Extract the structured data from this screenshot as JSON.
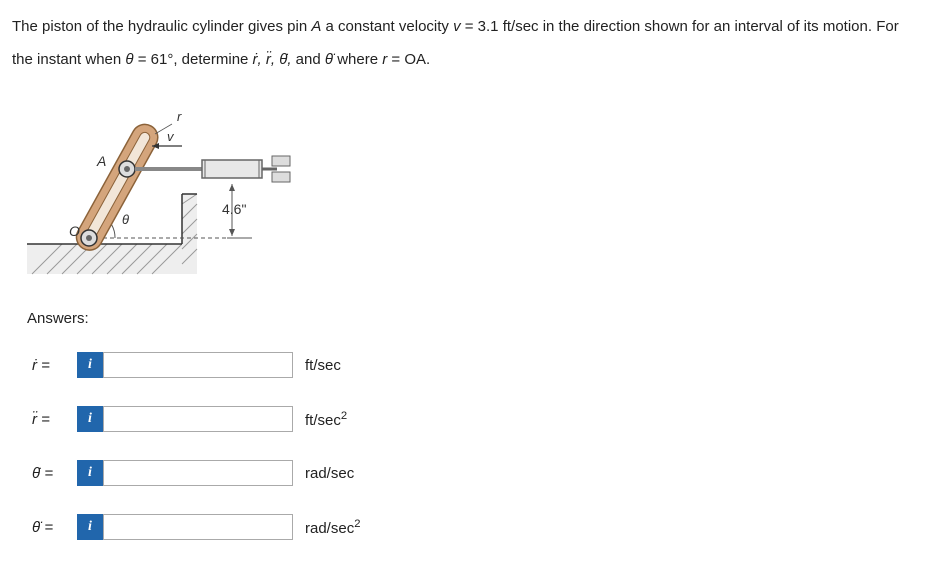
{
  "problem": {
    "line1_pre": "The piston of the hydraulic cylinder gives pin ",
    "line1_a": "A",
    "line1_mid": " a constant velocity ",
    "line1_v": "v",
    "line1_post": " = 3.1 ft/sec in the direction shown for an interval of its motion. For",
    "line2_pre": "the instant when ",
    "line2_theta": "θ",
    "line2_mid1": " = 61°, determine ",
    "line2_vars": "ṙ, r̈, θ̇,",
    "line2_mid2": "  and ",
    "line2_var2": "θ̈",
    "line2_mid3": " where ",
    "line2_r": "r",
    "line2_post": " = OA."
  },
  "diagram": {
    "dimension": "4.6\"",
    "labelA": "A",
    "labelO": "O",
    "labelTheta": "θ",
    "labelV": "v",
    "labelR": "r"
  },
  "answers_label": "Answers:",
  "answers": [
    {
      "var": "ṙ",
      "eq": "=",
      "unit": "ft/sec"
    },
    {
      "var": "r̈",
      "eq": "=",
      "unit": "ft/sec²"
    },
    {
      "var": "θ̇",
      "eq": "=",
      "unit": "rad/sec"
    },
    {
      "var": "θ̈",
      "eq": "=",
      "unit": "rad/sec²"
    }
  ],
  "info_icon": "i"
}
